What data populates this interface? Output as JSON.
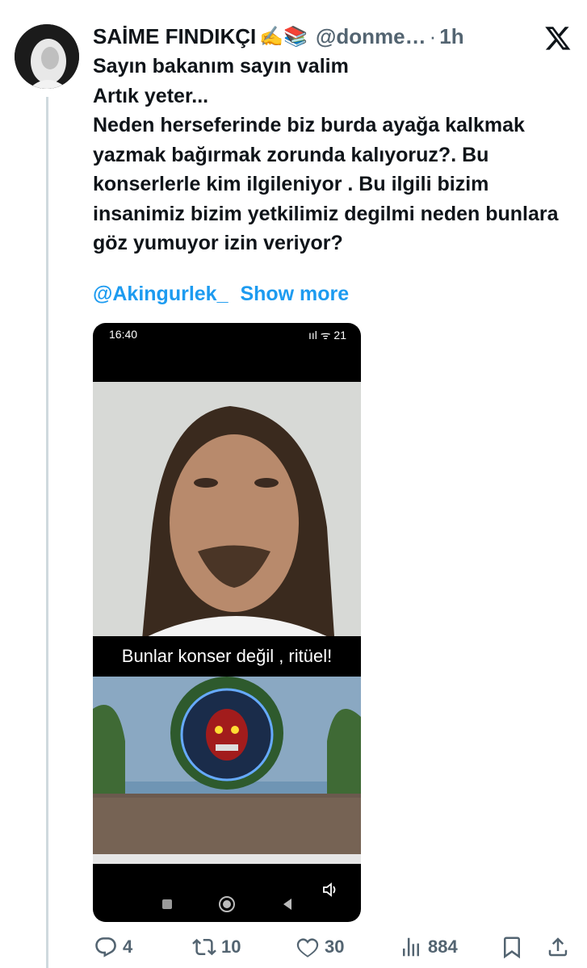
{
  "tweet": {
    "author_name": "SAİME FINDIKÇI",
    "author_emoji": "✍️📚",
    "handle": "@donme…",
    "separator": "·",
    "time": "1h",
    "paragraphs": [
      "Sayın bakanım sayın valim",
      "Artık yeter...",
      "Neden herseferinde biz burda ayağa kalkmak yazmak bağırmak zorunda kalıyoruz?. Bu konserlerle kim ilgileniyor . Bu ilgili bizim insanimiz bizim yetkilimiz degilmi neden bunlara göz yumuyor izin veriyor?"
    ],
    "mention": "@Akingurlek_",
    "show_more": "Show more"
  },
  "media": {
    "status_time": "16:40",
    "status_icons": "▪ ⋯",
    "status_right": "ııl ᯤ 21",
    "caption": "Bunlar konser değil , ritüel!"
  },
  "actions": {
    "replies": "4",
    "reposts": "10",
    "likes": "30",
    "views": "884"
  },
  "icons": [
    "x-logo-icon",
    "reply-icon",
    "repost-icon",
    "like-icon",
    "views-icon",
    "bookmark-icon",
    "share-icon",
    "volume-icon"
  ],
  "colors": {
    "link": "#1d9bf0",
    "muted": "#536471",
    "text": "#0f1419"
  }
}
